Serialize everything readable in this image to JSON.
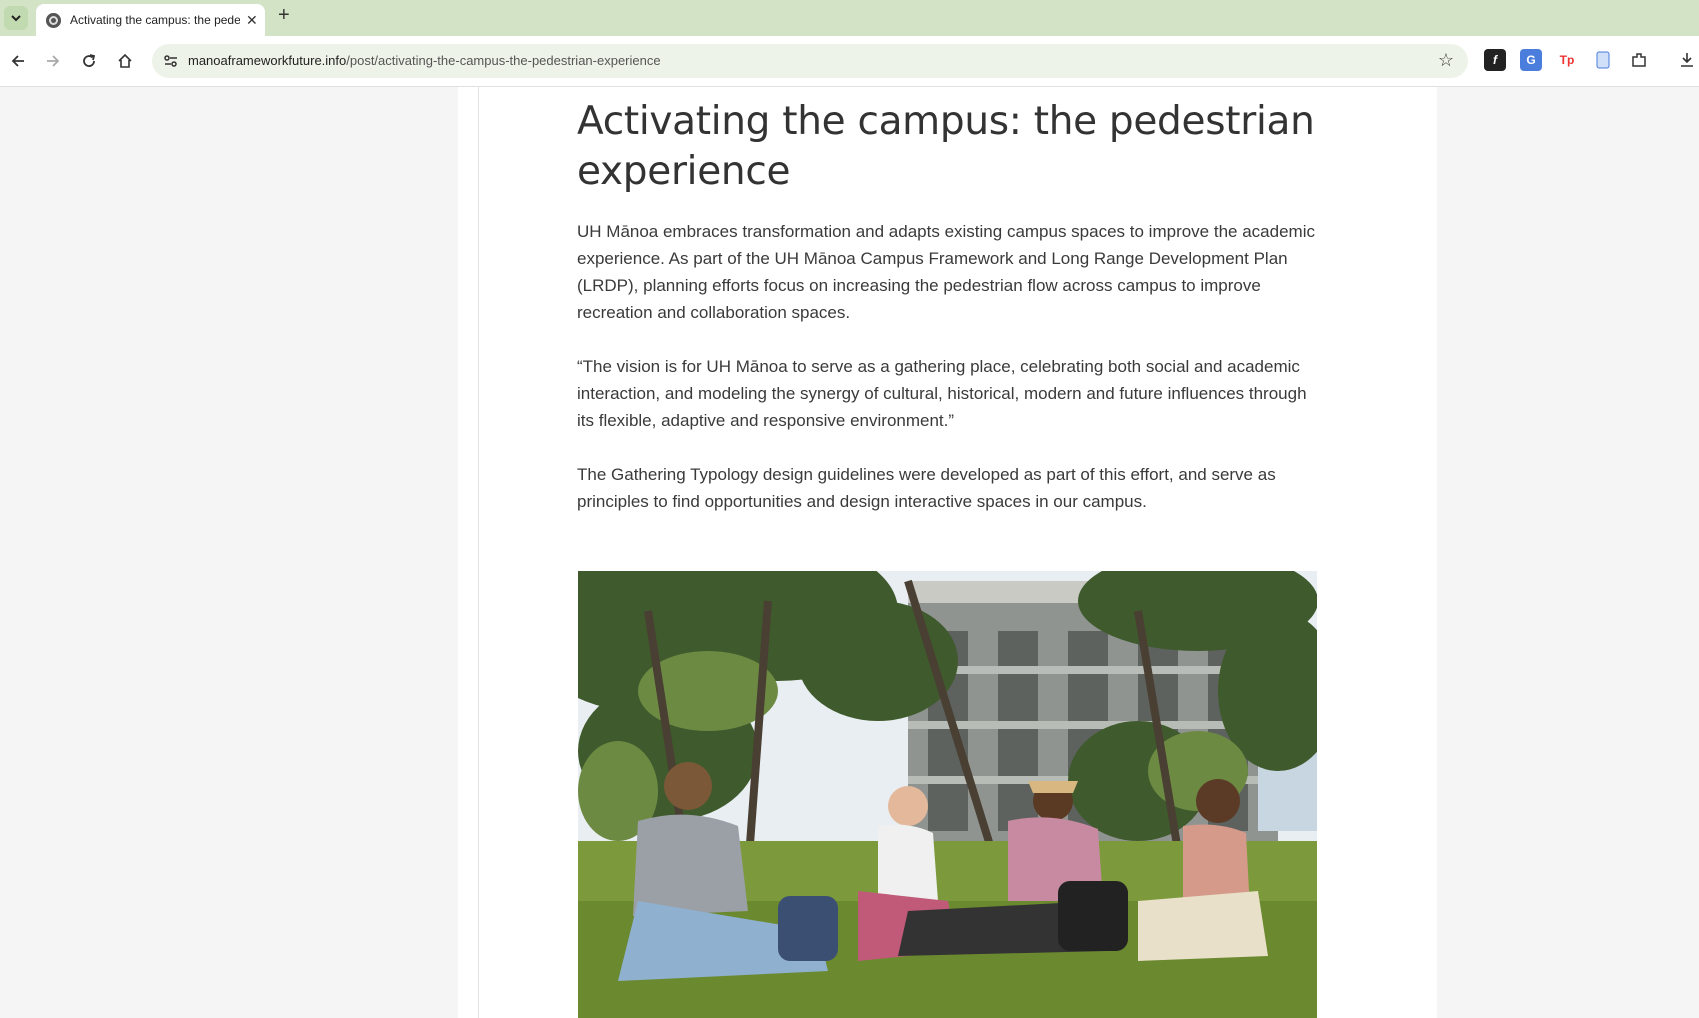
{
  "browser": {
    "tab_title": "Activating the campus: the pedestrian experience",
    "url_domain": "manoaframeworkfuture.info",
    "url_path": "/post/activating-the-campus-the-pedestrian-experience"
  },
  "article": {
    "title": "Activating the campus: the pedestrian experience",
    "paragraphs": [
      "UH Mānoa embraces transformation and adapts existing campus spaces to improve the academic experience. As part of the UH Mānoa Campus Framework and Long Range Development Plan (LRDP), planning efforts focus on increasing the pedestrian flow across campus to improve recreation and collaboration spaces.",
      "“The vision is for UH Mānoa to serve as a gathering place, celebrating both social and academic interaction, and modeling the synergy of cultural, historical, modern and future influences through its flexible, adaptive and responsive environment.”",
      "The Gathering Typology design guidelines were developed as part of this effort, and serve as principles to find opportunities and design interactive spaces in our campus."
    ]
  },
  "colors": {
    "tabstrip": "#d3e3c5",
    "omnibox": "#eef3e9",
    "text": "#3a3a3a"
  },
  "icons": [
    "tab-list-icon",
    "favicon-icon",
    "close-icon",
    "new-tab-icon",
    "back-icon",
    "forward-icon",
    "reload-icon",
    "home-icon",
    "site-info-icon",
    "star-icon",
    "extension-icon",
    "download-icon"
  ]
}
